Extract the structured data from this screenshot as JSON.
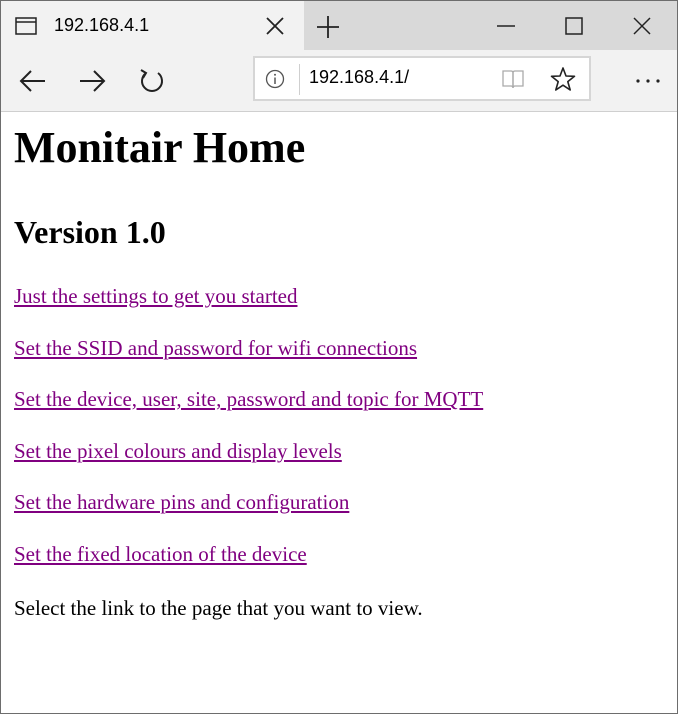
{
  "browser": {
    "tab_title": "192.168.4.1",
    "address_url": "192.168.4.1/",
    "icons": {
      "tab": "page-icon",
      "close_tab": "close-icon",
      "new_tab": "plus-icon",
      "minimize": "minimize-icon",
      "maximize": "maximize-icon",
      "close_window": "close-icon",
      "back": "back-arrow-icon",
      "forward": "forward-arrow-icon",
      "refresh": "refresh-icon",
      "site_info": "info-icon",
      "reading_view": "book-icon",
      "favorite": "star-icon",
      "more": "more-dots-icon"
    }
  },
  "page": {
    "title": "Monitair Home",
    "version": "Version 1.0",
    "links": [
      "Just the settings to get you started",
      "Set the SSID and password for wifi connections",
      "Set the device, user, site, password and topic for MQTT",
      "Set the pixel colours and display levels",
      "Set the hardware pins and configuration",
      "Set the fixed location of the device"
    ],
    "footer_text": "Select the link to the page that you want to view.",
    "link_color": "#800080"
  }
}
